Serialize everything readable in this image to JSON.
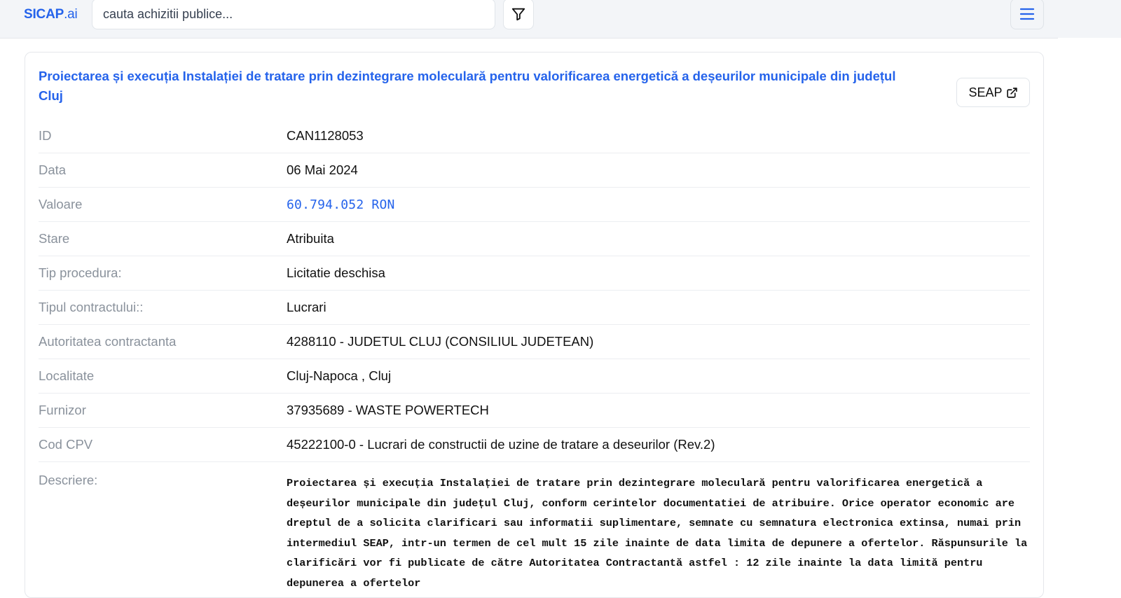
{
  "header": {
    "logo_main": "SICAP",
    "logo_suffix": ".ai",
    "search_placeholder": "cauta achizitii publice...",
    "filter_icon": "filter-icon",
    "menu_icon": "hamburger-menu-icon"
  },
  "tender": {
    "title": "Proiectarea și execuția Instalației de tratare prin dezintegrare moleculară pentru valorificarea energetică a deșeurilor municipale din județul Cluj",
    "seap_label": "SEAP",
    "seap_icon": "external-link-icon",
    "fields": [
      {
        "label": "ID",
        "value": "CAN1128053"
      },
      {
        "label": "Data",
        "value": "06 Mai 2024"
      },
      {
        "label": "Valoare",
        "value": "60.794.052 RON"
      },
      {
        "label": "Stare",
        "value": "Atribuita"
      },
      {
        "label": "Tip procedura:",
        "value": "Licitatie deschisa"
      },
      {
        "label": "Tipul contractului::",
        "value": "Lucrari"
      },
      {
        "label": "Autoritatea contractanta",
        "value": "4288110 - JUDETUL CLUJ (CONSILIUL JUDETEAN)"
      },
      {
        "label": "Localitate",
        "value": "Cluj-Napoca , Cluj"
      },
      {
        "label": "Furnizor",
        "value": "37935689 - WASTE POWERTECH"
      },
      {
        "label": "Cod CPV",
        "value": "45222100-0 - Lucrari de constructii de uzine de tratare a deseurilor (Rev.2)"
      }
    ],
    "description_label": "Descriere:",
    "description": "Proiectarea și execuția Instalației de tratare prin dezintegrare moleculară pentru valorificarea energetică a deșeurilor municipale din județul Cluj, conform cerintelor documentatiei de atribuire. Orice operator economic are dreptul de a solicita clarificari sau informatii suplimentare, semnate cu semnatura electronica extinsa, numai prin intermediul SEAP, intr-un termen de cel mult 15 zile inainte de data limita de depunere a ofertelor. Răspunsurile la clarificări vor fi publicate de către Autoritatea Contractantă astfel : 12 zile inainte la data limită pentru depunerea a ofertelor"
  },
  "colors": {
    "accent": "#2563eb",
    "label": "#8a929c",
    "topbar_bg": "#f3f5f8"
  }
}
